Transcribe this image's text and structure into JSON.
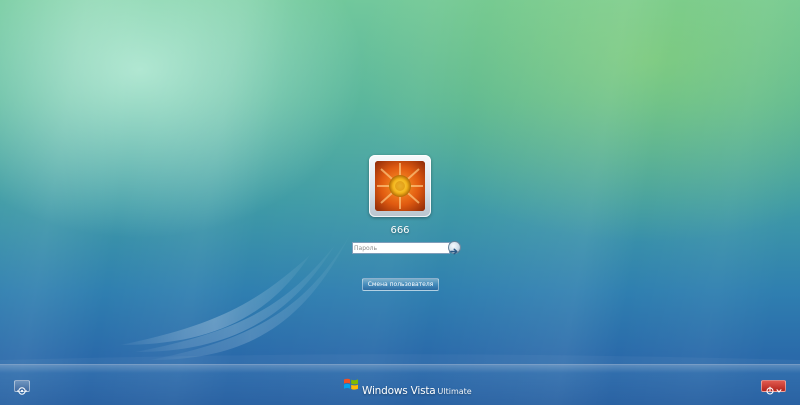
{
  "user": {
    "name": "666",
    "avatar_icon": "orange-flower-icon"
  },
  "password": {
    "placeholder": "Пароль",
    "value": ""
  },
  "actions": {
    "switch_user_label": "Смена пользователя",
    "submit_icon": "arrow-right-icon"
  },
  "branding": {
    "product": "Windows Vista",
    "edition": "Ultimate"
  },
  "bottom": {
    "ease_of_access_icon": "ease-of-access-icon",
    "power_icon": "power-icon"
  },
  "colors": {
    "accent_red": "#b3241d",
    "text": "#ffffff"
  }
}
